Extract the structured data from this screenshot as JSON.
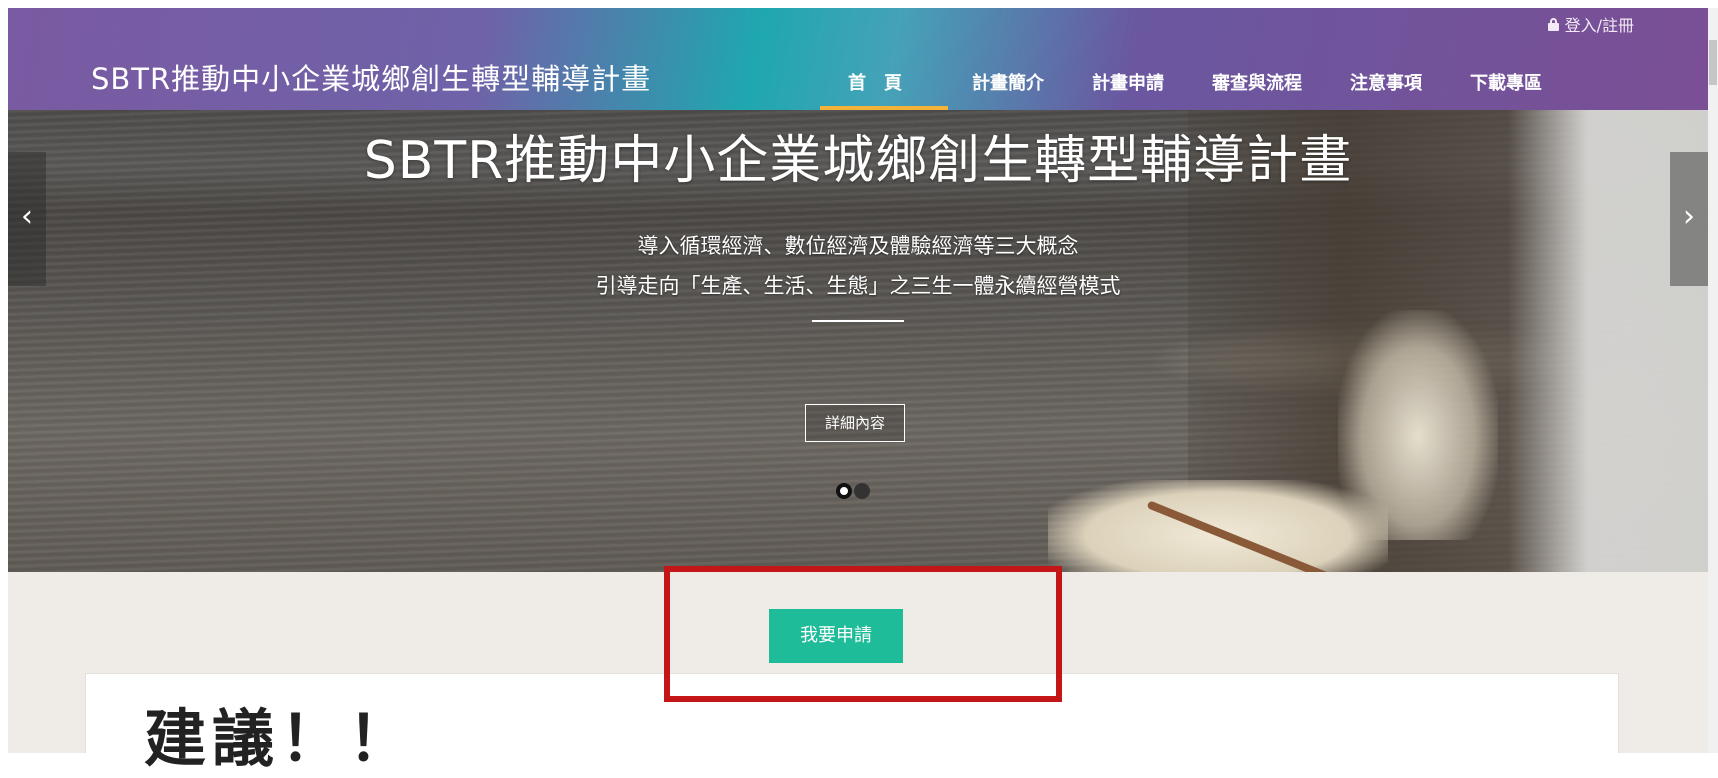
{
  "header": {
    "site_title": "SBTR推動中小企業城鄉創生轉型輔導計畫",
    "login_label": "登入/註冊",
    "nav": [
      {
        "label": "首頁",
        "active": true
      },
      {
        "label": "計畫簡介",
        "active": false
      },
      {
        "label": "計畫申請",
        "active": false
      },
      {
        "label": "審查與流程",
        "active": false
      },
      {
        "label": "注意事項",
        "active": false
      },
      {
        "label": "下載專區",
        "active": false
      }
    ]
  },
  "hero": {
    "title": "SBTR推動中小企業城鄉創生轉型輔導計畫",
    "subtitle_1": "導入循環經濟、數位經濟及體驗經濟等三大概念",
    "subtitle_2": "引導走向「生產、生活、生態」之三生一體永續經營模式",
    "detail_button": "詳細內容",
    "prev_arrow": "‹",
    "next_arrow": "›",
    "slide_count": 2,
    "active_slide": 1
  },
  "apply_button": "我要申請",
  "card": {
    "heading": "建議！！"
  },
  "colors": {
    "apply_button": "#1fbc99",
    "nav_active_underline": "#f3b23a",
    "highlight_box": "#c41616"
  }
}
